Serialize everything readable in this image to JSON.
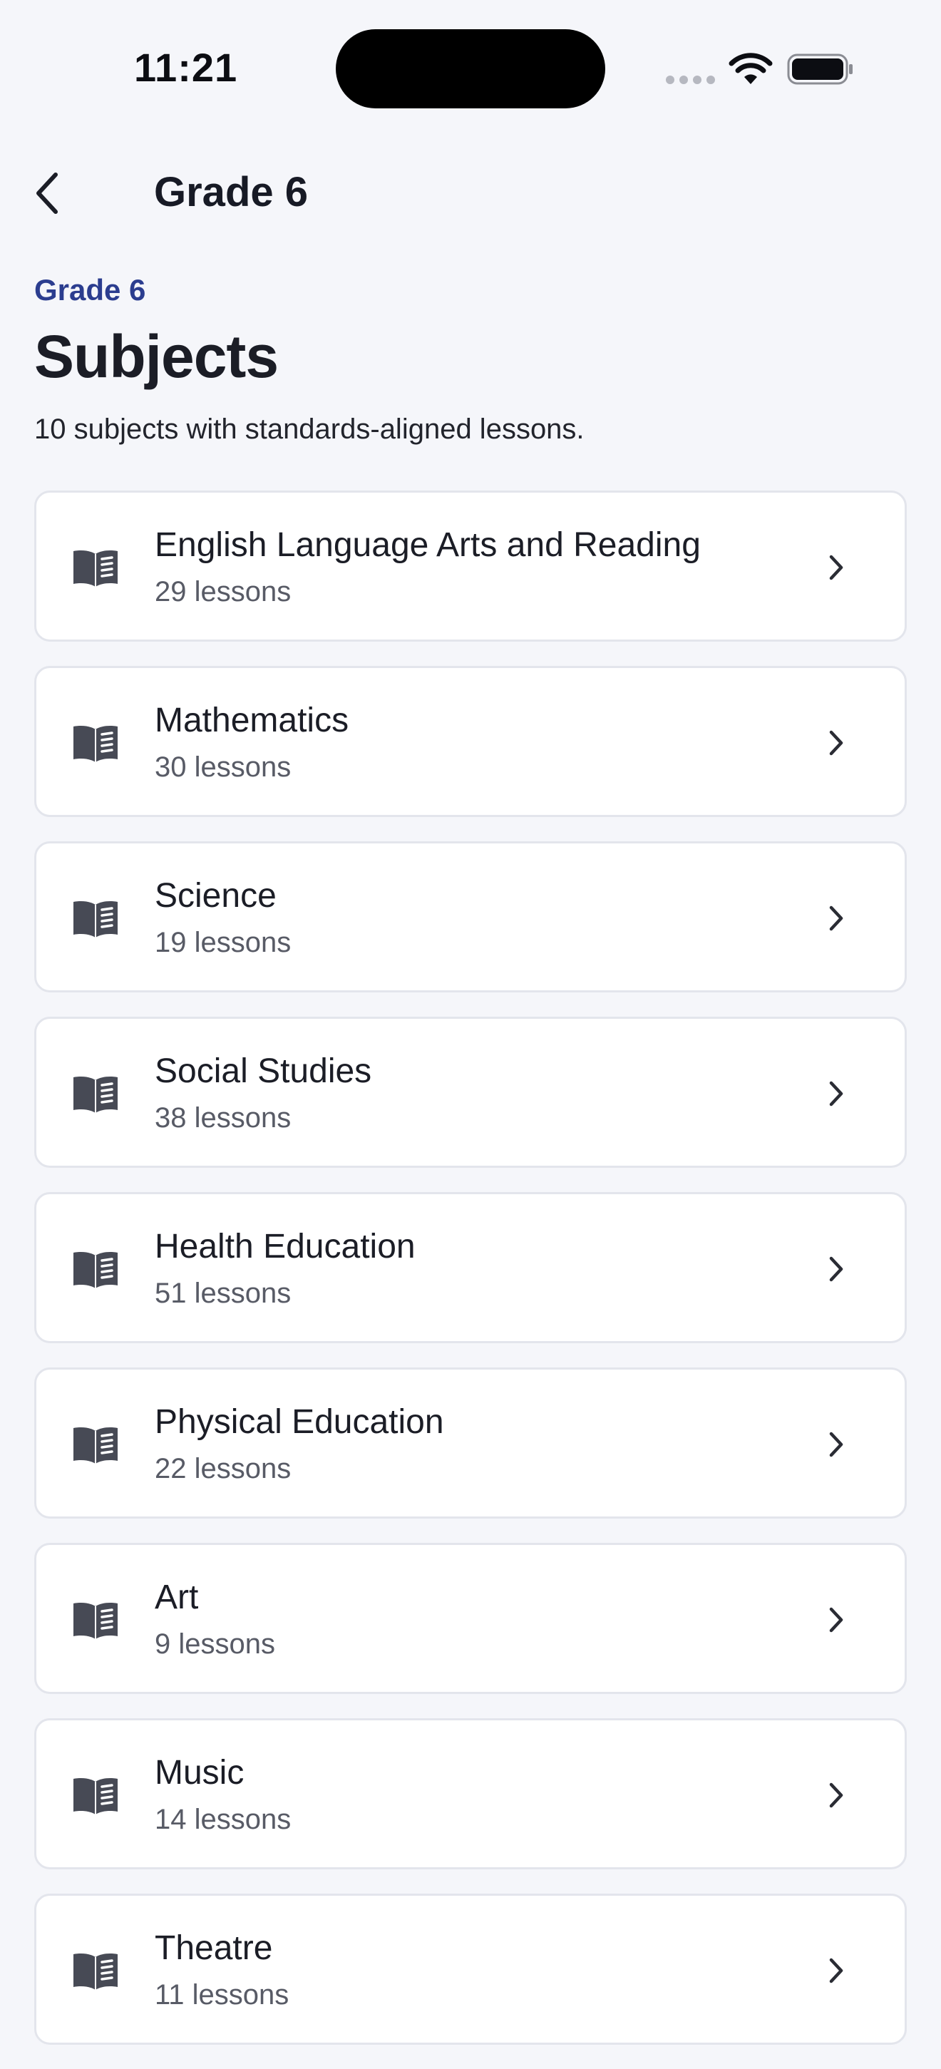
{
  "status_bar": {
    "time": "11:21"
  },
  "nav": {
    "back_icon": "chevron-left-icon",
    "title": "Grade 6"
  },
  "header": {
    "eyebrow": "Grade 6",
    "title": "Subjects",
    "subtitle": "10 subjects with standards-aligned lessons."
  },
  "subjects": [
    {
      "name": "English Language Arts and Reading",
      "count": "29 lessons",
      "icon": "book-icon"
    },
    {
      "name": "Mathematics",
      "count": "30 lessons",
      "icon": "book-icon"
    },
    {
      "name": "Science",
      "count": "19 lessons",
      "icon": "book-icon"
    },
    {
      "name": "Social Studies",
      "count": "38 lessons",
      "icon": "book-icon"
    },
    {
      "name": "Health Education",
      "count": "51 lessons",
      "icon": "book-icon"
    },
    {
      "name": "Physical Education",
      "count": "22 lessons",
      "icon": "book-icon"
    },
    {
      "name": "Art",
      "count": "9 lessons",
      "icon": "book-icon"
    },
    {
      "name": "Music",
      "count": "14 lessons",
      "icon": "book-icon"
    },
    {
      "name": "Theatre",
      "count": "11 lessons",
      "icon": "book-icon"
    }
  ],
  "colors": {
    "background": "#f5f6fa",
    "accent": "#2b3d8f",
    "card": "#ffffff",
    "card_border": "#e3e5ec",
    "icon": "#474a55"
  }
}
